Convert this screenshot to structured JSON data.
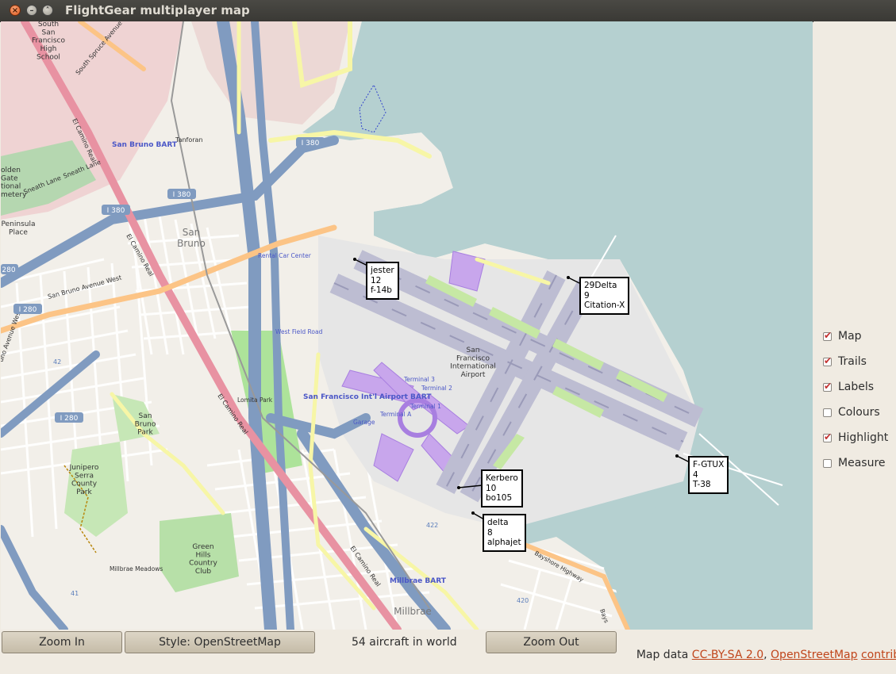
{
  "window": {
    "title": "FlightGear multiplayer map"
  },
  "map": {
    "place_labels": {
      "school": "South\nSan\nFrancisco\nHigh\nSchool",
      "san_bruno_bart": "San Bruno BART",
      "tanforan": "Tanforan",
      "golden_gate": "olden\nGate\ntional\nmetery",
      "peninsula_place": "Peninsula\nPlace",
      "san_bruno": "San\nBruno",
      "rental_car": "Rental Car Center",
      "west_field_road": "West Field Road",
      "airport": "San\nFrancisco\nInternational\nAirport",
      "sfo_bart": "San Francisco Int'l Airport BART",
      "terminal3": "Terminal 3",
      "terminal2": "Terminal 2",
      "terminal1": "Terminal 1",
      "terminala": "Terminal A",
      "garage": "Garage",
      "lomita_park": "Lomita Park",
      "san_bruno_park": "San\nBruno\nPark",
      "junipero": "Junipero\nSerra\nCounty\nPark",
      "green_hills": "Green\nHills\nCountry\nClub",
      "millbrae_meadows": "Millbrae Meadows",
      "millbrae_bart": "Millbrae BART",
      "millbrae": "Millbrae",
      "bayshore": "Bayshore Highway",
      "bays": "Bays"
    },
    "road_labels": {
      "spruce": "South Spruce Avenue",
      "el_camino_1": "El Camino Real",
      "el_camino_2": "El Camino Real",
      "el_camino_3": "El Camino Real",
      "el_camino_4": "El Camino Real",
      "sneath": "Sneath Lane",
      "sneath2": "Sneath Lane",
      "san_bruno_ave": "San Bruno Avenue West",
      "skyline": "uno Avenue West",
      "i380a": "I 380",
      "i380b": "I 380",
      "i380c": "I 380",
      "i280a": "280",
      "i280b": "I 280",
      "i280c": "I 280",
      "n42": "42",
      "n422": "422",
      "n420": "420",
      "n41": "41"
    }
  },
  "aircraft": [
    {
      "callsign": "jester",
      "line2": "12",
      "model": "f-14b"
    },
    {
      "callsign": "29Delta",
      "line2": "9",
      "model": "Citation-X"
    },
    {
      "callsign": "F-GTUX",
      "line2": "4",
      "model": "T-38"
    },
    {
      "callsign": "Kerbero",
      "line2": "10",
      "model": "bo105"
    },
    {
      "callsign": "delta",
      "line2": "8",
      "model": "alphajet"
    }
  ],
  "options": [
    {
      "label": "Map",
      "checked": true
    },
    {
      "label": "Trails",
      "checked": true
    },
    {
      "label": "Labels",
      "checked": true
    },
    {
      "label": "Colours",
      "checked": false
    },
    {
      "label": "Highlight",
      "checked": true
    },
    {
      "label": "Measure",
      "checked": false
    }
  ],
  "toolbar": {
    "zoom_in": "Zoom In",
    "style": "Style: OpenStreetMap",
    "status": "54 aircraft in world",
    "zoom_out": "Zoom Out",
    "attribution_prefix": "Map data ",
    "license_link": "CC-BY-SA 2.0",
    "sep": ", ",
    "osm_link": "OpenStreetMap",
    "space": " ",
    "contributors_link": "contributors"
  }
}
